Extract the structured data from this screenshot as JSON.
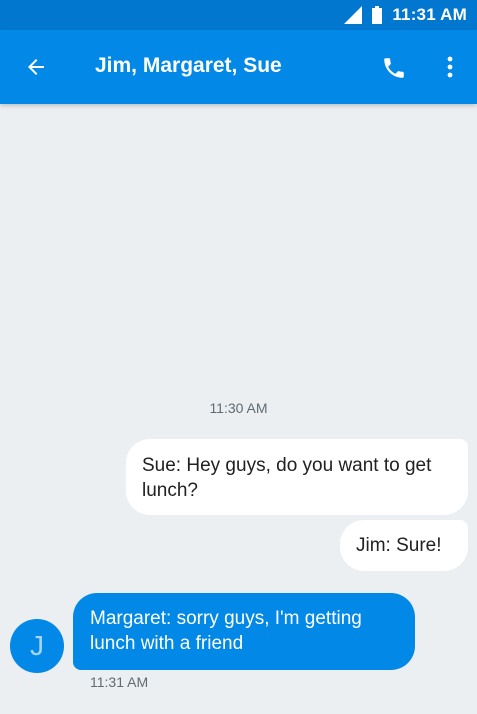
{
  "status_bar": {
    "time": "11:31 AM",
    "icons": [
      "signal-icon",
      "battery-icon"
    ]
  },
  "app_bar": {
    "title": "Jim, Margaret, Sue",
    "icons": [
      "back-arrow-icon",
      "phone-icon",
      "more-vert-icon"
    ]
  },
  "conversation": {
    "timestamp": "11:30 AM",
    "messages": [
      {
        "direction": "outgoing",
        "text": "Sue: Hey guys, do you want to get lunch?"
      },
      {
        "direction": "outgoing",
        "text": "Jim: Sure!"
      },
      {
        "direction": "incoming",
        "text": "Margaret: sorry guys, I'm getting lunch with a friend",
        "avatar_initial": "J",
        "time": "11:31 AM"
      }
    ]
  },
  "colors": {
    "status_bar": "#0277cf",
    "app_bar": "#0288e6",
    "background": "#eceff1",
    "outgoing_bubble": "#ffffff",
    "incoming_bubble": "#0288e6"
  }
}
